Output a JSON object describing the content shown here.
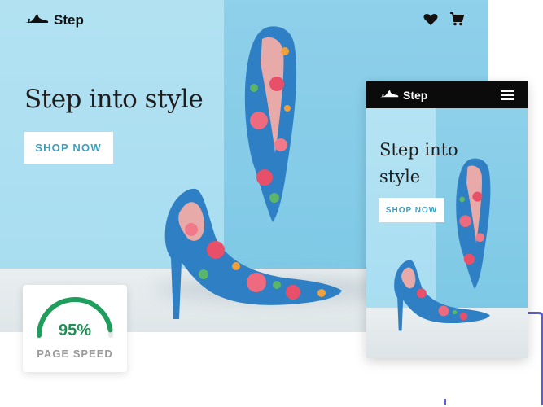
{
  "desktop": {
    "brand": "Step",
    "headline": "Step into style",
    "cta_label": "SHOP NOW",
    "icons": [
      "shoe-logo-icon",
      "heart-icon",
      "cart-icon"
    ]
  },
  "page_speed": {
    "value": "95%",
    "label": "PAGE SPEED",
    "fraction": 0.95,
    "color": "#1f9d5c"
  },
  "mobile": {
    "brand": "Step",
    "headline": "Step into style",
    "cta_label": "SHOP NOW",
    "icons": [
      "shoe-logo-icon",
      "hamburger-menu-icon"
    ]
  },
  "colors": {
    "accent": "#3aa0bf",
    "wall_light": "#b2e2f2",
    "wall_dark": "#7ec9e6",
    "mobile_header": "#0b0b0b",
    "decor_outline": "#5a5fd6"
  }
}
